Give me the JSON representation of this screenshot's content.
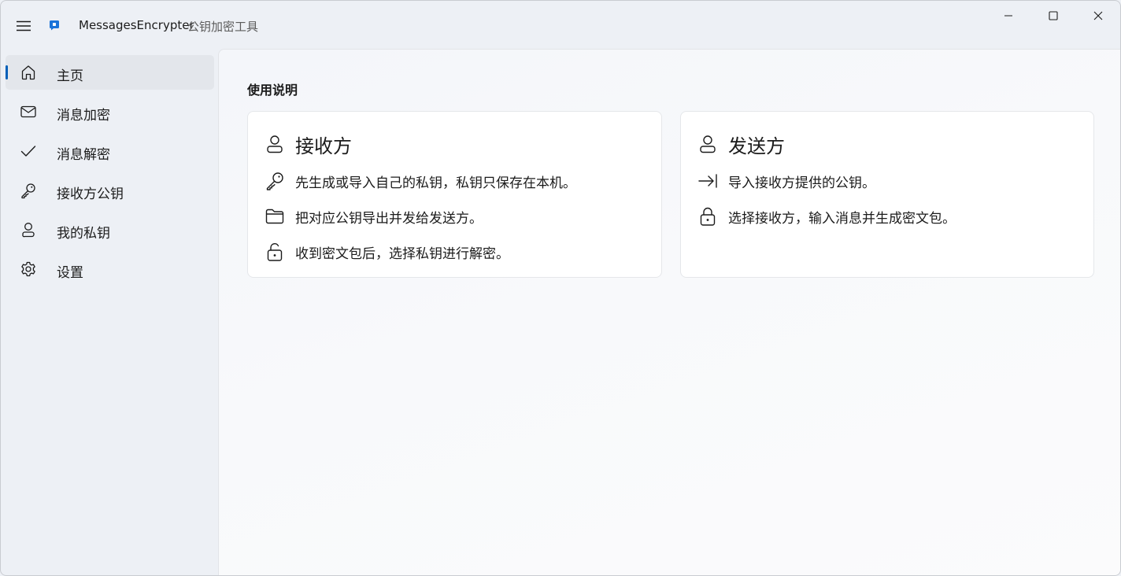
{
  "titlebar": {
    "app_name": "MessagesEncrypter",
    "app_subtitle": "公钥加密工具",
    "menu_icon": "hamburger-menu-icon",
    "app_icon": "app-logo-icon",
    "accent_color": "#005fb8"
  },
  "window_controls": {
    "minimize_icon": "minimize-icon",
    "maximize_icon": "maximize-icon",
    "close_icon": "close-icon"
  },
  "sidebar": {
    "items": [
      {
        "label": "主页",
        "icon": "home-icon",
        "selected": true
      },
      {
        "label": "消息加密",
        "icon": "mail-icon",
        "selected": false
      },
      {
        "label": "消息解密",
        "icon": "checkmark-icon",
        "selected": false
      },
      {
        "label": "接收方公钥",
        "icon": "key-icon",
        "selected": false
      },
      {
        "label": "我的私钥",
        "icon": "person-icon",
        "selected": false
      },
      {
        "label": "设置",
        "icon": "gear-icon",
        "selected": false
      }
    ]
  },
  "main": {
    "section_title": "使用说明",
    "cards": [
      {
        "title": "接收方",
        "icon": "person-icon",
        "rows": [
          {
            "icon": "key-icon",
            "text": "先生成或导入自己的私钥，私钥只保存在本机。"
          },
          {
            "icon": "folder-icon",
            "text": "把对应公钥导出并发给发送方。"
          },
          {
            "icon": "unlock-icon",
            "text": "收到密文包后，选择私钥进行解密。"
          }
        ]
      },
      {
        "title": "发送方",
        "icon": "person-icon",
        "rows": [
          {
            "icon": "import-arrow-icon",
            "text": "导入接收方提供的公钥。"
          },
          {
            "icon": "lock-icon",
            "text": "选择接收方，输入消息并生成密文包。"
          }
        ]
      }
    ]
  }
}
